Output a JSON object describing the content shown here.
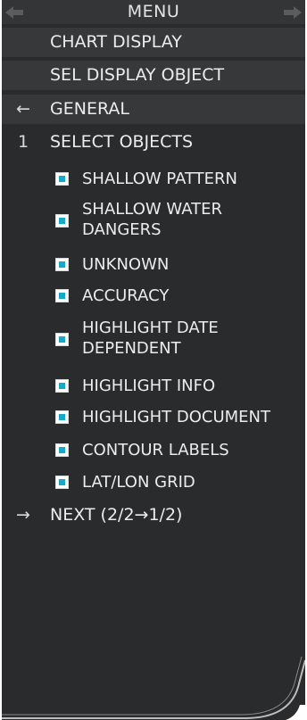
{
  "menu": {
    "title": "MENU",
    "back_icon": "arrow-left-icon",
    "forward_icon": "arrow-right-icon"
  },
  "nav": {
    "chart_display": "CHART DISPLAY",
    "sel_display_object": "SEL DISPLAY OBJECT",
    "general_arrow": "←",
    "general": "GENERAL",
    "select_objects_index": "1",
    "select_objects": "SELECT OBJECTS"
  },
  "options": [
    {
      "label": "SHALLOW PATTERN",
      "checked": true
    },
    {
      "label": "SHALLOW WATER",
      "label2": "DANGERS",
      "checked": true
    },
    {
      "label": "UNKNOWN",
      "checked": true
    },
    {
      "label": "ACCURACY",
      "checked": true
    },
    {
      "label": "HIGHLIGHT DATE",
      "label2": "DEPENDENT",
      "checked": true
    },
    {
      "label": "HIGHLIGHT INFO",
      "checked": true
    },
    {
      "label": "HIGHLIGHT DOCUMENT",
      "checked": true
    },
    {
      "label": "CONTOUR LABELS",
      "checked": true
    },
    {
      "label": "LAT/LON GRID",
      "checked": true
    }
  ],
  "next": {
    "arrow": "→",
    "label": "NEXT (2/2→1/2)"
  },
  "colors": {
    "panel_bg": "#2a2b2c",
    "row_highlight": "#373839",
    "checkbox_fill": "#1ba8c8"
  }
}
